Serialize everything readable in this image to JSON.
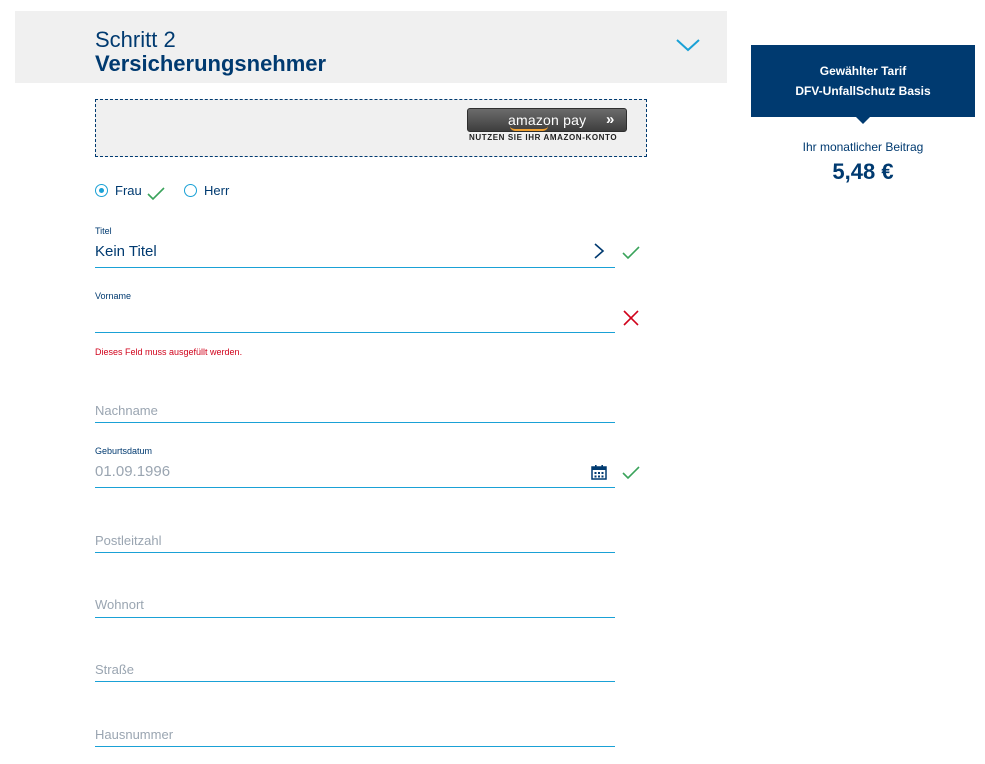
{
  "header": {
    "step_number": "Schritt 2",
    "step_title": "Versicherungsnehmer"
  },
  "amazon": {
    "logo_text": "amazon pay",
    "caption": "NUTZEN SIE IHR AMAZON-KONTO"
  },
  "salutation": {
    "options": [
      "Frau",
      "Herr"
    ],
    "selected": "Frau",
    "status": "valid"
  },
  "form": {
    "titel": {
      "label": "Titel",
      "value": "Kein Titel",
      "status": "valid"
    },
    "vorname": {
      "label": "Vorname",
      "value": "",
      "status": "invalid",
      "error": "Dieses Feld muss ausgefüllt werden."
    },
    "nachname": {
      "placeholder": "Nachname"
    },
    "geburtsdatum": {
      "label": "Geburtsdatum",
      "value": "01.09.1996",
      "status": "valid"
    },
    "postleitzahl": {
      "placeholder": "Postleitzahl"
    },
    "wohnort": {
      "placeholder": "Wohnort"
    },
    "strasse": {
      "placeholder": "Straße"
    },
    "hausnummer": {
      "placeholder": "Hausnummer"
    }
  },
  "sidebar": {
    "selected_label": "Gewählter Tarif",
    "tariff_name": "DFV-UnfallSchutz Basis",
    "price_label": "Ihr monatlicher Beitrag",
    "price_value": "5,48 €"
  },
  "colors": {
    "primary": "#003a70",
    "accent": "#1aa1d6",
    "valid": "#3aa35b",
    "error": "#d0021b",
    "header_bg": "#f0f0f0"
  },
  "icons": {
    "header_toggle": "chevron-down-icon",
    "select_arrow": "chevron-right-icon",
    "valid": "checkmark-icon",
    "invalid": "cross-icon",
    "date_picker": "calendar-icon"
  }
}
